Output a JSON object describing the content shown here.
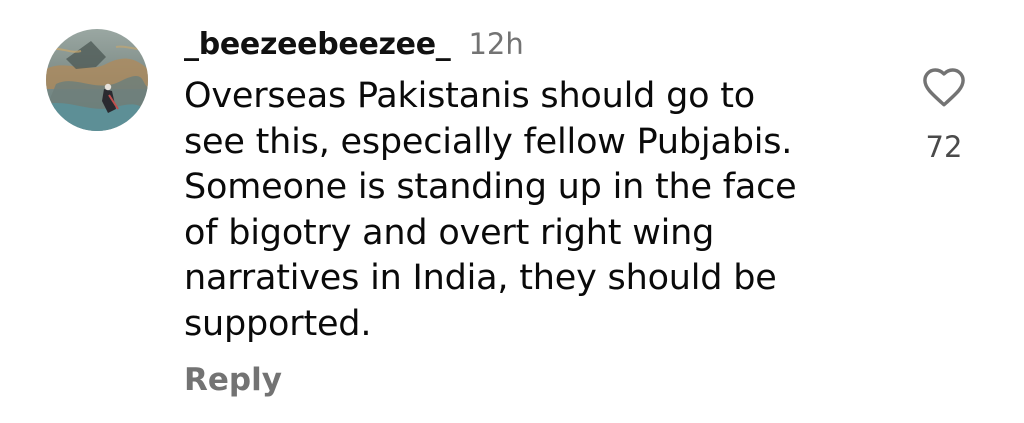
{
  "comment": {
    "username": "_beezeebeezee_",
    "timestamp": "12h",
    "text_lines": [
      "Overseas Pakistanis should go to",
      "see this, especially fellow Pubjabis.",
      "Someone is standing up in the face",
      "of bigotry and overt right wing",
      "narratives in India, they should be",
      "supported."
    ],
    "reply_label": "Reply",
    "like_icon": "heart-outline-icon",
    "like_count": "72"
  },
  "colors": {
    "secondary_text": "#737373",
    "primary_text": "#0a0a0a",
    "background": "#ffffff"
  }
}
